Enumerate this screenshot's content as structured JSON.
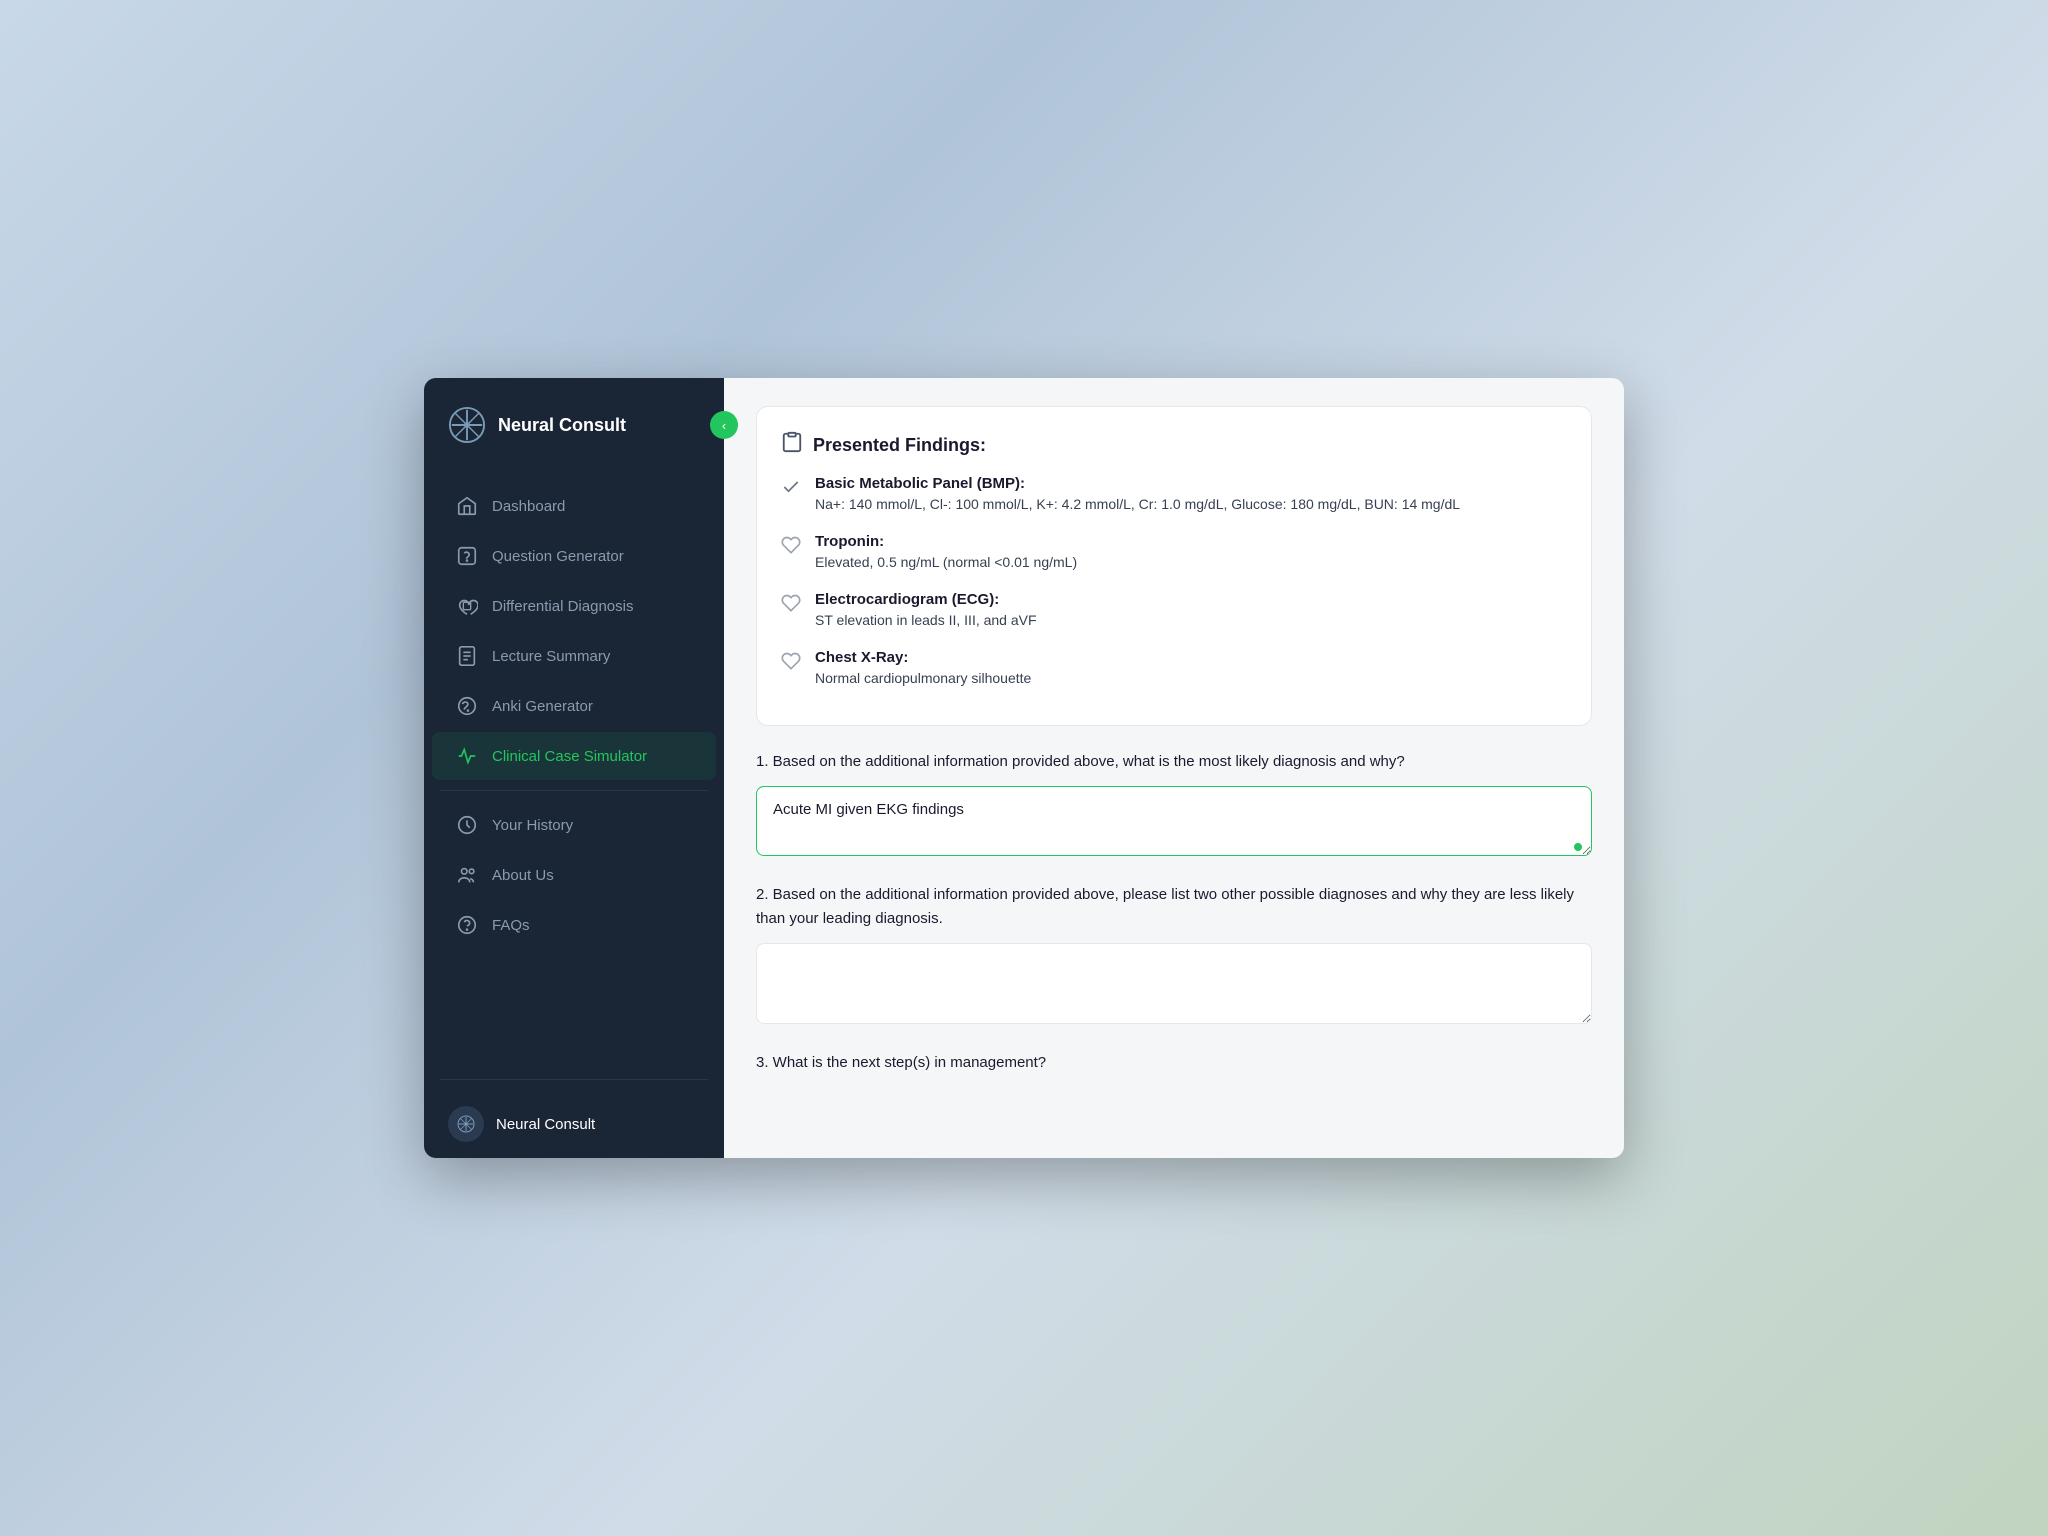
{
  "app": {
    "name": "Neural Consult",
    "collapse_button": "<"
  },
  "sidebar": {
    "nav_items": [
      {
        "id": "dashboard",
        "label": "Dashboard",
        "icon": "home",
        "active": false
      },
      {
        "id": "question-generator",
        "label": "Question Generator",
        "icon": "question",
        "active": false
      },
      {
        "id": "differential-diagnosis",
        "label": "Differential Diagnosis",
        "icon": "heart-shield",
        "active": false
      },
      {
        "id": "lecture-summary",
        "label": "Lecture Summary",
        "icon": "document",
        "active": false
      },
      {
        "id": "anki-generator",
        "label": "Anki Generator",
        "icon": "brain",
        "active": false
      },
      {
        "id": "clinical-case-simulator",
        "label": "Clinical Case Simulator",
        "icon": "activity",
        "active": true
      }
    ],
    "bottom_items": [
      {
        "id": "your-history",
        "label": "Your History",
        "icon": "clock"
      },
      {
        "id": "about-us",
        "label": "About Us",
        "icon": "user-group"
      },
      {
        "id": "faqs",
        "label": "FAQs",
        "icon": "help-circle"
      }
    ],
    "footer": {
      "label": "Neural Consult",
      "icon": "snowflake"
    }
  },
  "main": {
    "findings_title": "Presented Findings:",
    "findings": [
      {
        "id": "bmp",
        "name": "Basic Metabolic Panel (BMP):",
        "value": "Na+: 140 mmol/L, Cl-: 100 mmol/L, K+: 4.2 mmol/L, Cr: 1.0 mg/dL, Glucose: 180 mg/dL, BUN: 14 mg/dL",
        "icon": "check"
      },
      {
        "id": "troponin",
        "name": "Troponin:",
        "value": "Elevated, 0.5 ng/mL (normal <0.01 ng/mL)",
        "icon": "heart"
      },
      {
        "id": "ecg",
        "name": "Electrocardiogram (ECG):",
        "value": "ST elevation in leads II, III, and aVF",
        "icon": "heart"
      },
      {
        "id": "chest-xray",
        "name": "Chest X-Ray:",
        "value": "Normal cardiopulmonary silhouette",
        "icon": "heart"
      }
    ],
    "questions": [
      {
        "id": "q1",
        "number": "1",
        "text": "Based on the additional information provided above, what is the most likely diagnosis and why?",
        "answer": "Acute MI given EKG findings",
        "placeholder": ""
      },
      {
        "id": "q2",
        "number": "2",
        "text": "Based on the additional information provided above, please list two other possible diagnoses and why they are less likely than your leading diagnosis.",
        "answer": "",
        "placeholder": ""
      },
      {
        "id": "q3",
        "number": "3",
        "text": "What is the next step(s) in management?",
        "answer": "",
        "placeholder": ""
      }
    ]
  }
}
